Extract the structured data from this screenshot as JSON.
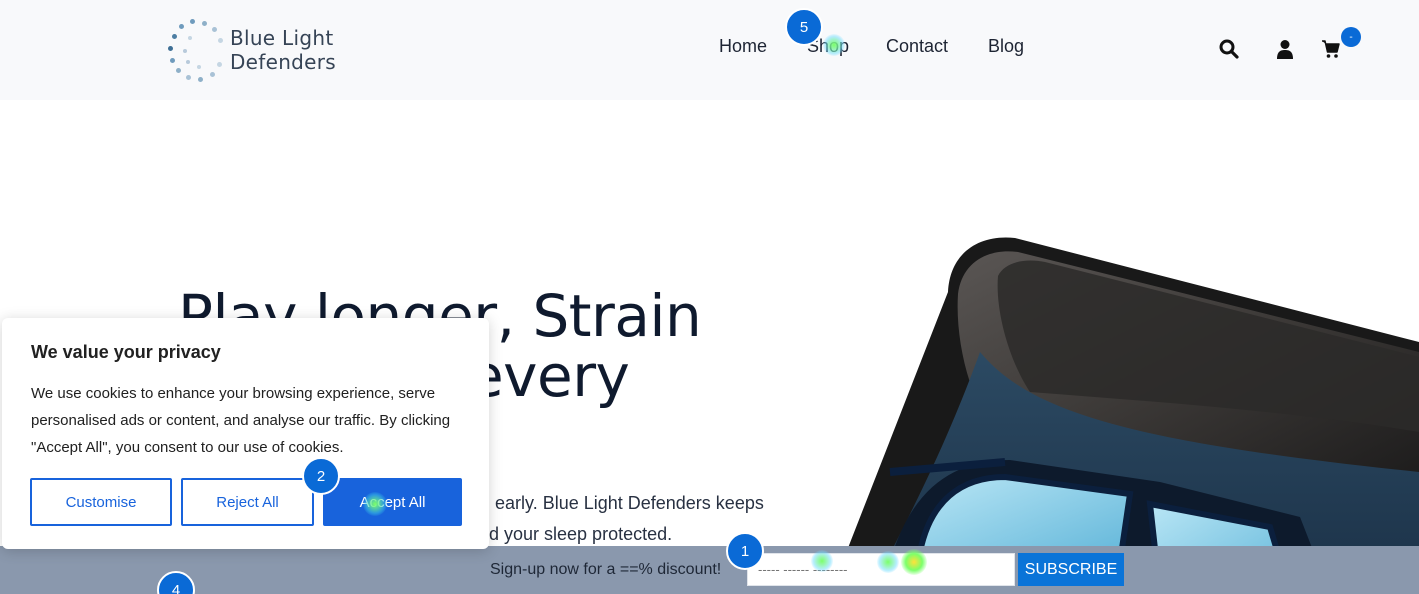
{
  "site": {
    "logo_text": "Blue Light Defenders"
  },
  "nav": {
    "home": "Home",
    "shop": "Shop",
    "contact": "Contact",
    "blog": "Blog"
  },
  "header_icons": [
    "search-icon",
    "account-icon",
    "cart-icon"
  ],
  "cart": {
    "badge": "-"
  },
  "hero": {
    "title_line1": "Play longer, Strain",
    "title_line2": "every",
    "text_line1": "n early. Blue Light Defenders keeps",
    "text_line2": "d your sleep protected."
  },
  "subscribe": {
    "label": "Sign-up now for a ==% discount!",
    "placeholder": "----- ------ --------",
    "button": "SUBSCRIBE"
  },
  "cookie": {
    "title": "We value your privacy",
    "text": "We use cookies to enhance your browsing experience, serve personalised ads or content, and analyse our traffic. By clicking \"Accept All\", you consent to our use of cookies.",
    "customise": "Customise",
    "reject": "Reject All",
    "accept": "Accept All"
  },
  "markers": [
    "1",
    "2",
    "4",
    "5"
  ],
  "colors": {
    "accent": "#1863dc",
    "brand_blue": "#0a6ad6",
    "subscribe_bar": "#8a98ad"
  }
}
